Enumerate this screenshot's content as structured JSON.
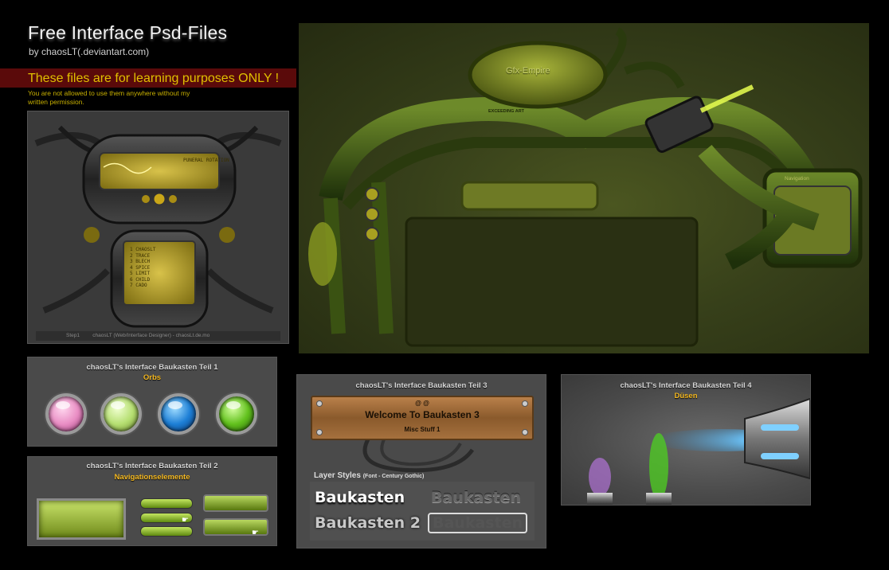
{
  "header": {
    "title": "Free Interface Psd-Files",
    "byline": "by chaosLT(.deviantart.com)",
    "banner": "These files are for learning purposes ONLY !",
    "disclaimer": "You are not allowed to use them anywhere without my written permission."
  },
  "step1_panel": {
    "footer": "Step1         chaosLT (Web/Interface Designer) - chaosLt.de.mo",
    "menu_items": [
      "1 CHAOSLT",
      "2 TRACE",
      "3 BLECH",
      "4 SPICE",
      "5 LIMIT",
      "6 CHILD",
      "7 CADO"
    ],
    "screen_text": "PUNERAL ROTATION"
  },
  "main_panel": {
    "logo": "Gfx-Empire",
    "tagline": "EXCEEDING ART",
    "nav_label": "Navigation"
  },
  "teil1": {
    "title": "chaosLT's Interface Baukasten Teil 1",
    "subtitle": "Orbs",
    "orbs": [
      "#e98ec4",
      "#b6df72",
      "#1d7fd6",
      "#62c11d"
    ]
  },
  "teil2": {
    "title": "chaosLT's Interface Baukasten Teil 2",
    "subtitle": "Navigationselemente"
  },
  "teil3": {
    "title": "chaosLT's Interface Baukasten Teil 3",
    "board_top": "@ @",
    "board_main": "Welcome To Baukasten 3",
    "board_sub": "Misc Stuff 1",
    "layer_styles_label": "Layer Styles",
    "layer_styles_font": "(Font - Century Gothic)",
    "words": [
      "Baukasten",
      "Baukasten",
      "Baukasten 2",
      "Baukasten"
    ]
  },
  "teil4": {
    "title": "chaosLT's Interface Baukasten Teil 4",
    "subtitle": "Düsen"
  }
}
